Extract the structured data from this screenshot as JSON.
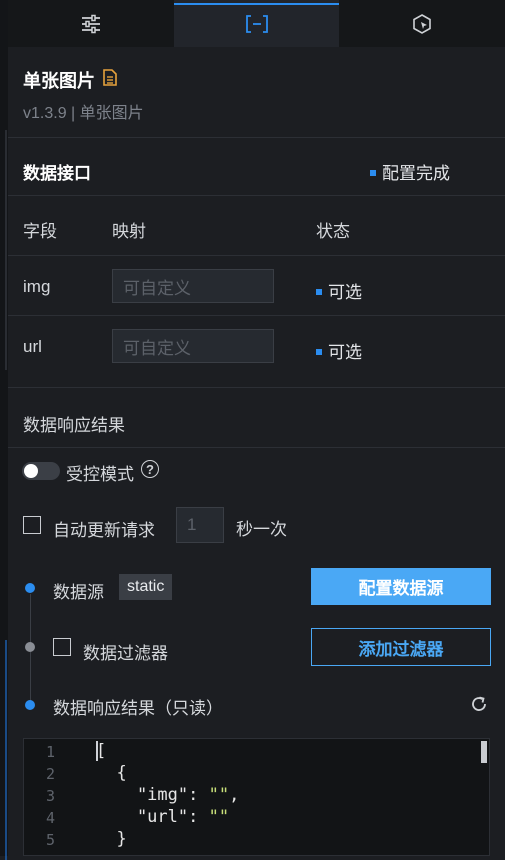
{
  "tabs": [
    {
      "icon": "sliders-icon"
    },
    {
      "icon": "bracket-icon",
      "active": true
    },
    {
      "icon": "cursor-icon"
    }
  ],
  "component": {
    "title": "单张图片",
    "version_line": "v1.3.9 | 单张图片"
  },
  "data_interface": {
    "title": "数据接口",
    "status": "配置完成",
    "columns": {
      "field": "字段",
      "mapping": "映射",
      "status": "状态"
    },
    "rows": [
      {
        "field": "img",
        "placeholder": "可自定义",
        "status": "可选"
      },
      {
        "field": "url",
        "placeholder": "可自定义",
        "status": "可选"
      }
    ]
  },
  "response": {
    "title": "数据响应结果",
    "controlled_mode": "受控模式",
    "help": "?",
    "auto_update_label": "自动更新请求",
    "interval_value": "1",
    "interval_unit": "秒一次"
  },
  "pipeline": {
    "source_label": "数据源",
    "source_tag": "static",
    "configure_button": "配置数据源",
    "filter_label": "数据过滤器",
    "add_filter_button": "添加过滤器",
    "result_label": "数据响应结果（只读）"
  },
  "editor": {
    "line_numbers": [
      "1",
      "2",
      "3",
      "4",
      "5"
    ],
    "lines": [
      "[",
      "  {",
      "    \"img\": \"\",",
      "    \"url\": \"\"",
      "  }"
    ]
  },
  "colors": {
    "accent": "#2b8df0",
    "primary_button": "#4aa8f5",
    "background": "#1c1e22"
  }
}
